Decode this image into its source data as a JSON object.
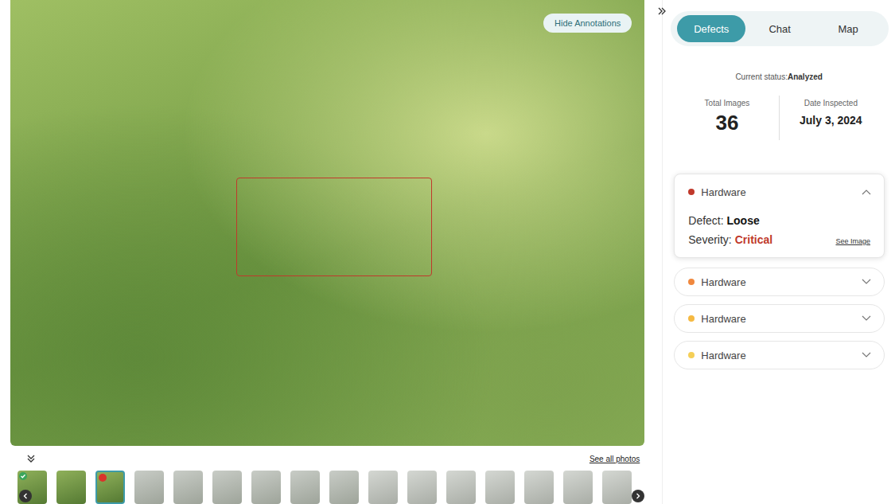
{
  "viewer": {
    "annotations_button": "Hide Annotations",
    "annotations_visible": true
  },
  "gallery": {
    "see_all": "See all photos",
    "thumbnails": [
      {
        "selected": false,
        "checked": true,
        "flagged": false
      },
      {
        "selected": false,
        "checked": false,
        "flagged": false
      },
      {
        "selected": true,
        "checked": false,
        "flagged": true
      },
      {
        "selected": false,
        "checked": false,
        "flagged": false
      },
      {
        "selected": false,
        "checked": false,
        "flagged": false
      },
      {
        "selected": false,
        "checked": false,
        "flagged": false
      },
      {
        "selected": false,
        "checked": false,
        "flagged": false
      },
      {
        "selected": false,
        "checked": false,
        "flagged": false
      },
      {
        "selected": false,
        "checked": false,
        "flagged": false
      },
      {
        "selected": false,
        "checked": false,
        "flagged": false
      },
      {
        "selected": false,
        "checked": false,
        "flagged": false
      },
      {
        "selected": false,
        "checked": false,
        "flagged": false
      },
      {
        "selected": false,
        "checked": false,
        "flagged": false
      },
      {
        "selected": false,
        "checked": false,
        "flagged": false
      },
      {
        "selected": false,
        "checked": false,
        "flagged": false
      },
      {
        "selected": false,
        "checked": false,
        "flagged": false
      }
    ]
  },
  "tabs": [
    {
      "label": "Defects",
      "selected": true
    },
    {
      "label": "Chat",
      "selected": false
    },
    {
      "label": "Map",
      "selected": false
    }
  ],
  "status": {
    "label": "Current status:",
    "value": "Analyzed"
  },
  "stats": [
    {
      "label": "Total Images",
      "value": "36",
      "kind": "count"
    },
    {
      "label": "Date Inspected",
      "value": "July 3, 2024",
      "kind": "date"
    }
  ],
  "defects": [
    {
      "category": "Hardware",
      "color": "#c0392b",
      "expanded": true,
      "defect_label": "Defect:",
      "defect": "Loose",
      "severity_label": "Severity:",
      "severity": "Critical",
      "link": "See Image"
    },
    {
      "category": "Hardware",
      "color": "#f0883e",
      "expanded": false
    },
    {
      "category": "Hardware",
      "color": "#f5b942",
      "expanded": false
    },
    {
      "category": "Hardware",
      "color": "#f5cf57",
      "expanded": false
    }
  ]
}
